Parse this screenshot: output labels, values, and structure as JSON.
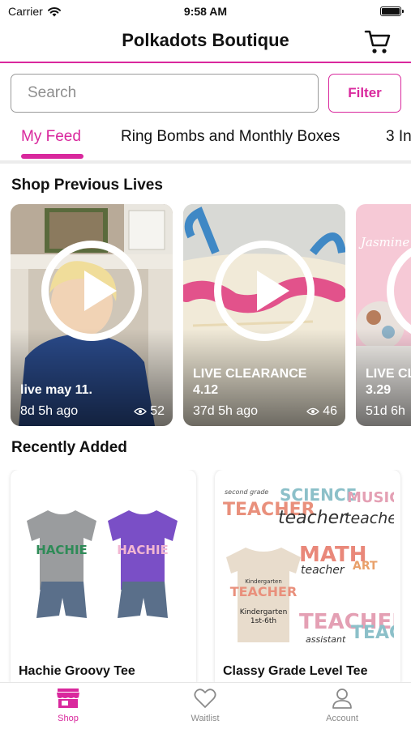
{
  "status_bar": {
    "carrier": "Carrier",
    "time": "9:58 AM"
  },
  "header": {
    "title": "Polkadots Boutique"
  },
  "search": {
    "placeholder": "Search",
    "filter_label": "Filter"
  },
  "tabs": [
    {
      "label": "My Feed",
      "active": true
    },
    {
      "label": "Ring Bombs and Monthly Boxes",
      "active": false
    },
    {
      "label": "3 In",
      "active": false
    }
  ],
  "sections": {
    "previous_lives": "Shop Previous Lives",
    "recently_added": "Recently Added"
  },
  "lives": [
    {
      "title": "live may 11.",
      "age": "8d 5h ago",
      "views": "52"
    },
    {
      "title": "LIVE CLEARANCE 4.12",
      "age": "37d 5h ago",
      "views": "46"
    },
    {
      "title": "LIVE CL 3.29",
      "age": "51d 6h",
      "views": ""
    }
  ],
  "products": [
    {
      "name": "Hachie Groovy Tee",
      "shirt_text": "HACHIE"
    },
    {
      "name": "Classy Grade Level Tee",
      "image_text": [
        "second grade",
        "TEACHER",
        "SCIENCE",
        "teacher",
        "MUSIC",
        "MATH",
        "ART",
        "Kindergarten",
        "TEACHER",
        "Kindergarten",
        "1st-6th",
        "assistant"
      ]
    }
  ],
  "bottom_nav": [
    {
      "label": "Shop",
      "icon": "store-icon",
      "active": true
    },
    {
      "label": "Waitlist",
      "icon": "heart-icon",
      "active": false
    },
    {
      "label": "Account",
      "icon": "person-icon",
      "active": false
    }
  ],
  "colors": {
    "accent": "#d9289d",
    "inactive": "#8a8a8a"
  }
}
